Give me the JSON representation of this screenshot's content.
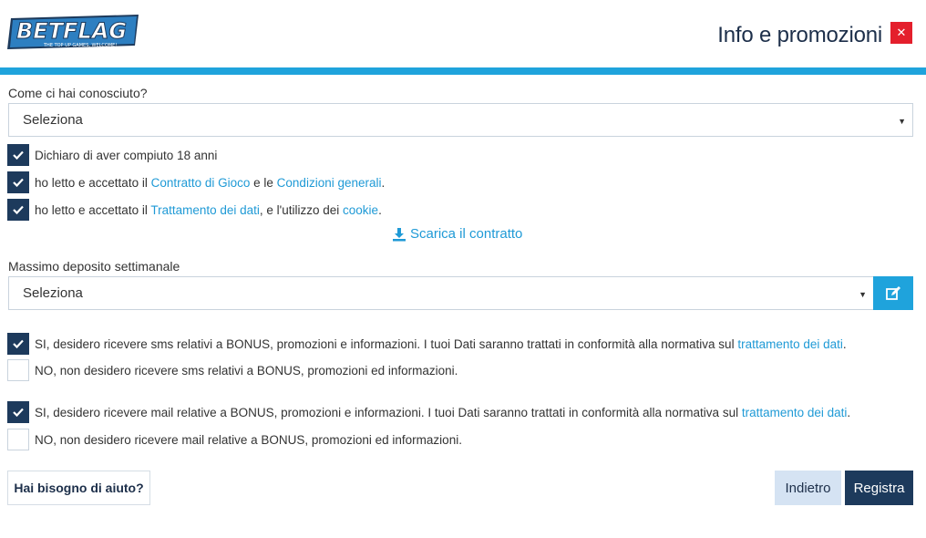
{
  "header": {
    "logo_text": "BETFLAG",
    "logo_tagline": "THE TOP UP GAMES, WELCOME!",
    "title": "Info e promozioni",
    "close_symbol": "✕"
  },
  "referral": {
    "label": "Come ci hai conosciuto?",
    "value": "Seleziona"
  },
  "consents": [
    {
      "checked": true,
      "text": "Dichiaro di aver compiuto 18 anni"
    },
    {
      "checked": true,
      "pre": "ho letto e accettato il ",
      "link1": "Contratto di Gioco",
      "mid": " e le ",
      "link2": "Condizioni generali",
      "post": "."
    },
    {
      "checked": true,
      "pre": "ho letto e accettato il ",
      "link1": "Trattamento dei dati",
      "mid": ", e l'utilizzo dei ",
      "link2": "cookie",
      "post": "."
    }
  ],
  "download_label": "Scarica il contratto",
  "deposit": {
    "label": "Massimo deposito settimanale",
    "value": "Seleziona"
  },
  "sms": {
    "yes": {
      "checked": true,
      "text": "SI, desidero ricevere sms relativi a BONUS, promozioni e informazioni. I tuoi Dati saranno trattati in conformità alla normativa sul ",
      "link": "trattamento dei dati",
      "post": "."
    },
    "no": {
      "checked": false,
      "text": "NO, non desidero ricevere sms relativi a BONUS, promozioni ed informazioni."
    }
  },
  "mail": {
    "yes": {
      "checked": true,
      "text": "SI, desidero ricevere mail relative a BONUS, promozioni e informazioni. I tuoi Dati saranno trattati in conformità alla normativa sul ",
      "link": "trattamento dei dati",
      "post": "."
    },
    "no": {
      "checked": false,
      "text": "NO, non desidero ricevere mail relative a BONUS, promozioni ed informazioni."
    }
  },
  "footer": {
    "help_label": "Hai bisogno di aiuto?",
    "back_label": "Indietro",
    "register_label": "Registra"
  },
  "colors": {
    "accent": "#1fa3dc",
    "dark_navy": "#1d3a5c",
    "close_red": "#e41f2c",
    "link": "#1f9ad6"
  }
}
